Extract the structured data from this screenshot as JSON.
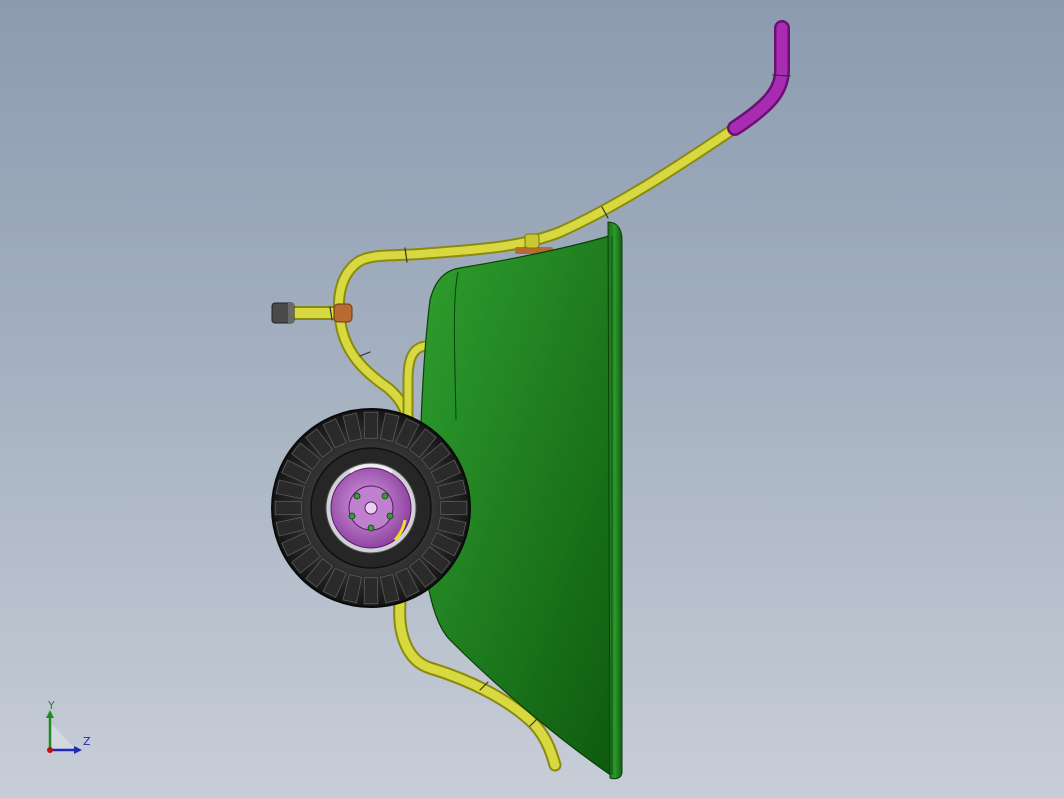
{
  "viewport": {
    "background_top": "#8c9bb0",
    "background_bottom": "#c8ced8"
  },
  "model": {
    "parts": [
      "tray",
      "frame",
      "handle-grip",
      "wheel-tire",
      "wheel-hub",
      "handle-end-cap",
      "leg"
    ],
    "colors": {
      "tray": "#1f7a1f",
      "frame": "#c8c832",
      "handle_grip": "#a020a8",
      "tire": "#1e1e1e",
      "hub": "#b070c0",
      "end_cap": "#555555",
      "bracket": "#b86a30"
    }
  },
  "triad": {
    "y_label": "Y",
    "z_label": "Z",
    "y_color": "#1f8a1f",
    "z_color": "#1a2fb0",
    "x_color": "#c01010"
  }
}
